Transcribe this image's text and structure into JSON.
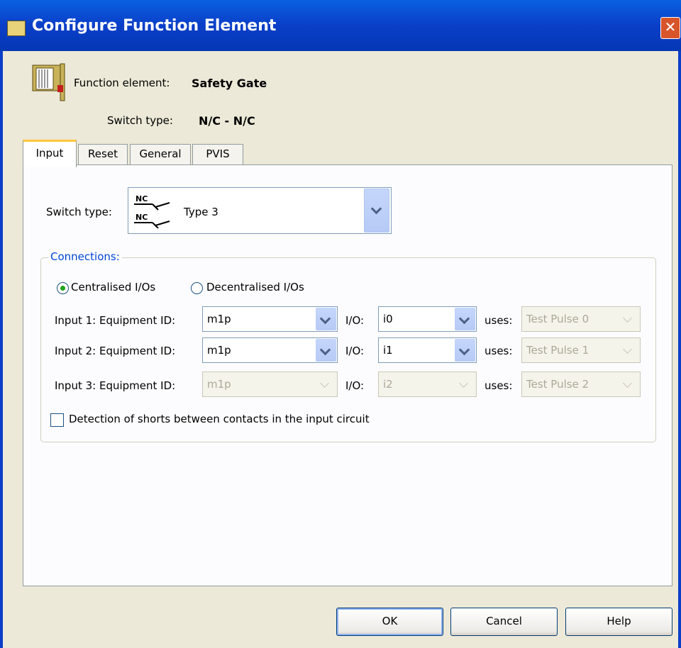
{
  "window": {
    "title": "Configure Function Element",
    "close_label": "✕"
  },
  "header": {
    "function_element_label": "Function element:",
    "function_element_value": "Safety Gate",
    "switch_type_label": "Switch type:",
    "switch_type_value": "N/C - N/C"
  },
  "tabs": [
    {
      "label": "Input",
      "active": true
    },
    {
      "label": "Reset",
      "active": false
    },
    {
      "label": "General",
      "active": false
    },
    {
      "label": "PVIS",
      "active": false
    }
  ],
  "input_tab": {
    "switch_type_label": "Switch type:",
    "switch_type_symbol": {
      "top": "NC",
      "bottom": "NC"
    },
    "switch_type_value": "Type 3",
    "connections": {
      "title": "Connections:",
      "radio_centralised": {
        "label": "Centralised I/Os",
        "checked": true
      },
      "radio_decentralised": {
        "label": "Decentralised I/Os",
        "checked": false
      },
      "io_label": "I/O:",
      "uses_label": "uses:",
      "rows": [
        {
          "label": "Input 1: Equipment ID:",
          "equipment": "m1p",
          "io": "i0",
          "uses": "Test Pulse 0",
          "enabled": true
        },
        {
          "label": "Input 2: Equipment ID:",
          "equipment": "m1p",
          "io": "i1",
          "uses": "Test Pulse 1",
          "enabled": true
        },
        {
          "label": "Input 3: Equipment ID:",
          "equipment": "m1p",
          "io": "i2",
          "uses": "Test Pulse 2",
          "enabled": false
        }
      ],
      "detect_shorts": {
        "label": "Detection of shorts between contacts in the input circuit",
        "checked": false
      }
    }
  },
  "buttons": {
    "ok": "OK",
    "cancel": "Cancel",
    "help": "Help"
  },
  "colors": {
    "titlebar": "#0a3fc8",
    "group_title": "#0046d5",
    "active_tab_accent": "#ffc83c"
  }
}
